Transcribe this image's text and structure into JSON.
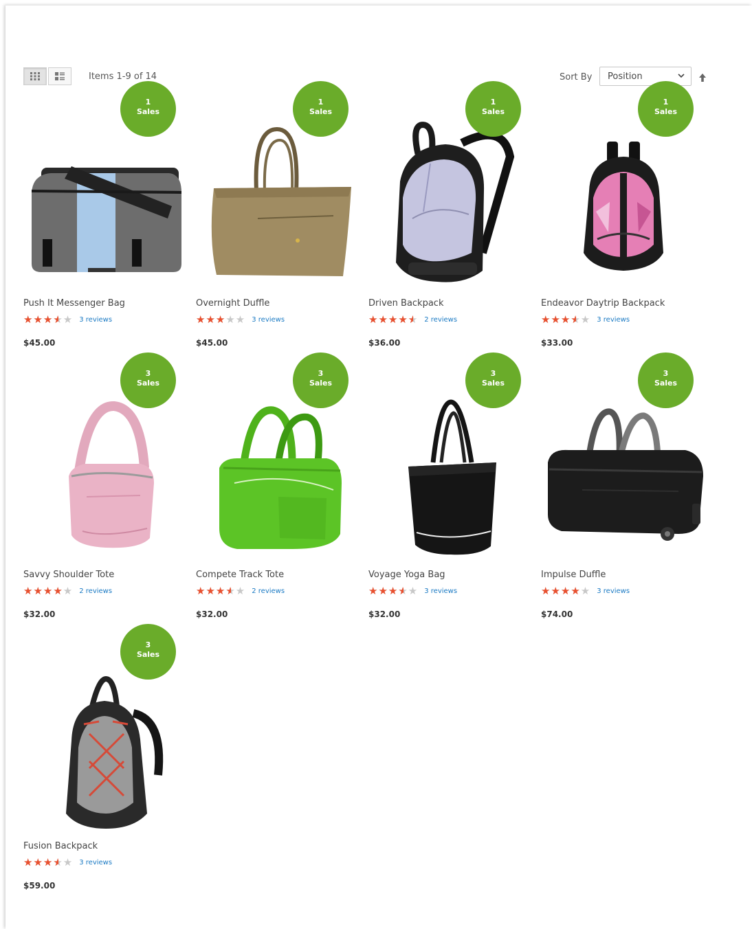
{
  "toolbar": {
    "view_grid_icon": "grid-icon",
    "view_list_icon": "list-icon",
    "amount": "Items 1-9 of 14",
    "sort_label": "Sort By",
    "sort_selected": "Position",
    "sort_direction_icon": "arrow-up-icon"
  },
  "badge_color": "#6aac2a",
  "star_color": "#e9502f",
  "products": [
    {
      "name": "Push It Messenger Bag",
      "price": "$45.00",
      "reviews": "3 reviews",
      "rating": 3.5,
      "sales_count": "1",
      "sales_label": "Sales"
    },
    {
      "name": "Overnight Duffle",
      "price": "$45.00",
      "reviews": "3 reviews",
      "rating": 3,
      "sales_count": "1",
      "sales_label": "Sales"
    },
    {
      "name": "Driven Backpack",
      "price": "$36.00",
      "reviews": "2 reviews",
      "rating": 4.5,
      "sales_count": "1",
      "sales_label": "Sales"
    },
    {
      "name": "Endeavor Daytrip Backpack",
      "price": "$33.00",
      "reviews": "3 reviews",
      "rating": 3.5,
      "sales_count": "1",
      "sales_label": "Sales"
    },
    {
      "name": "Savvy Shoulder Tote",
      "price": "$32.00",
      "reviews": "2 reviews",
      "rating": 4,
      "sales_count": "3",
      "sales_label": "Sales"
    },
    {
      "name": "Compete Track Tote",
      "price": "$32.00",
      "reviews": "2 reviews",
      "rating": 3.5,
      "sales_count": "3",
      "sales_label": "Sales"
    },
    {
      "name": "Voyage Yoga Bag",
      "price": "$32.00",
      "reviews": "3 reviews",
      "rating": 3.5,
      "sales_count": "3",
      "sales_label": "Sales"
    },
    {
      "name": "Impulse Duffle",
      "price": "$74.00",
      "reviews": "3 reviews",
      "rating": 4,
      "sales_count": "3",
      "sales_label": "Sales"
    },
    {
      "name": "Fusion Backpack",
      "price": "$59.00",
      "reviews": "3 reviews",
      "rating": 3.5,
      "sales_count": "3",
      "sales_label": "Sales"
    }
  ]
}
